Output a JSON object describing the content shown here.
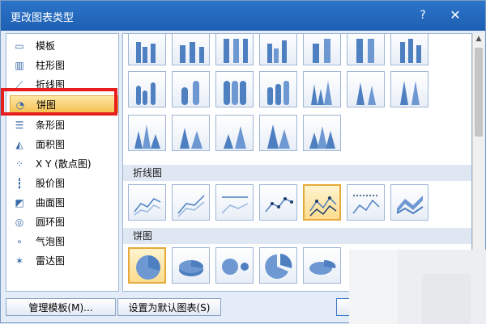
{
  "dialog": {
    "title": "更改图表类型",
    "help_label": "?",
    "close_label": "✕"
  },
  "categories": [
    {
      "label": "模板",
      "icon": "folder-icon"
    },
    {
      "label": "柱形图",
      "icon": "column-chart-icon"
    },
    {
      "label": "折线图",
      "icon": "line-chart-icon"
    },
    {
      "label": "饼图",
      "icon": "pie-chart-icon",
      "selected": true
    },
    {
      "label": "条形图",
      "icon": "bar-chart-icon"
    },
    {
      "label": "面积图",
      "icon": "area-chart-icon"
    },
    {
      "label": "X Y (散点图)",
      "icon": "scatter-chart-icon"
    },
    {
      "label": "股价图",
      "icon": "stock-chart-icon"
    },
    {
      "label": "曲面图",
      "icon": "surface-chart-icon"
    },
    {
      "label": "圆环图",
      "icon": "doughnut-chart-icon"
    },
    {
      "label": "气泡图",
      "icon": "bubble-chart-icon"
    },
    {
      "label": "雷达图",
      "icon": "radar-chart-icon"
    }
  ],
  "sections": {
    "line": "折线图",
    "pie": "饼图"
  },
  "buttons": {
    "manage_templates": "管理模板(M)...",
    "set_default": "设置为默认图表(S)"
  },
  "colors": {
    "title_bar": "#2b74c8",
    "selection": "#f6c153",
    "highlight_box": "#e81e1e",
    "chart_blue": "#4d7fc1"
  }
}
